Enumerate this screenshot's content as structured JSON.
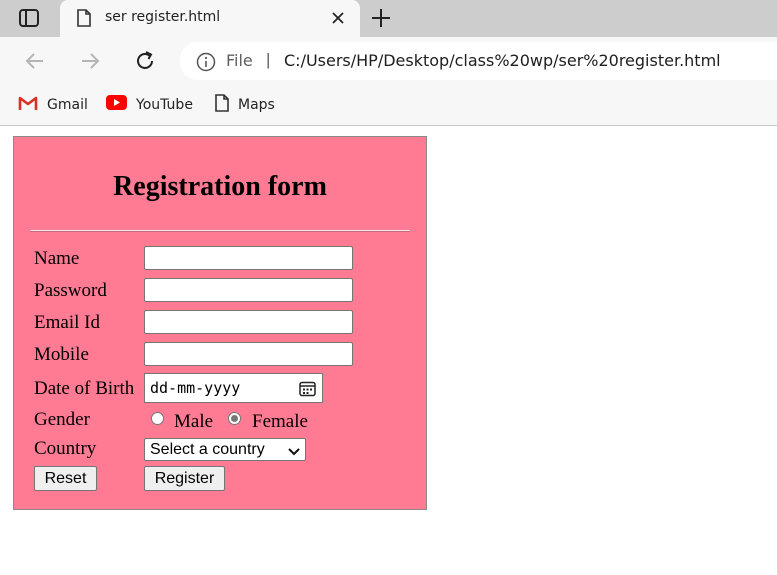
{
  "browser": {
    "tab": {
      "title": "ser register.html"
    },
    "address": {
      "scheme_label": "File",
      "separator": "|",
      "url": "C:/Users/HP/Desktop/class%20wp/ser%20register.html"
    },
    "bookmarks": [
      {
        "label": "Gmail",
        "icon": "gmail-icon"
      },
      {
        "label": "YouTube",
        "icon": "youtube-icon"
      },
      {
        "label": "Maps",
        "icon": "page-icon"
      }
    ]
  },
  "form": {
    "title": "Registration form",
    "fields": {
      "name_label": "Name",
      "password_label": "Password",
      "email_label": "Email Id",
      "mobile_label": "Mobile",
      "dob_label": "Date of Birth",
      "dob_placeholder": "dd-mm-yyyy",
      "gender_label": "Gender",
      "gender_options": [
        "Male",
        "Female"
      ],
      "gender_selected": "Female",
      "country_label": "Country",
      "country_selected": "Select a country"
    },
    "buttons": {
      "reset": "Reset",
      "register": "Register"
    }
  },
  "colors": {
    "form_background": "#ff7b94",
    "tabstrip": "#cdcdcd",
    "toolbar": "#f7f7f7"
  }
}
